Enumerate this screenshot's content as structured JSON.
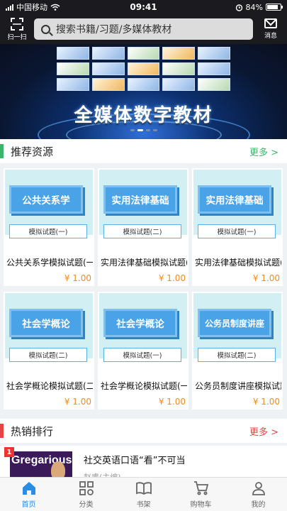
{
  "status": {
    "carrier": "中国移动",
    "time": "09:41",
    "battery": "84%"
  },
  "header": {
    "scan_label": "扫一扫",
    "search_placeholder": "搜索书籍/习题/多媒体教材",
    "message_label": "消息"
  },
  "banner": {
    "title": "全媒体数字教材",
    "dot_count": 4,
    "active_dot": 1
  },
  "recommend": {
    "title": "推荐资源",
    "more": "更多 >",
    "accent": "#3bb56b",
    "items": [
      {
        "cover_title": "公共关系学",
        "cover_sub": "模拟试题(一)",
        "name": "公共关系学模拟试题(一)",
        "price": "¥ 1.00"
      },
      {
        "cover_title": "实用法律基础",
        "cover_sub": "模拟试题(二)",
        "name": "实用法律基础模拟试题(二)",
        "price": "¥ 1.00"
      },
      {
        "cover_title": "实用法律基础",
        "cover_sub": "模拟试题(一)",
        "name": "实用法律基础模拟试题(一)",
        "price": "¥ 1.00"
      },
      {
        "cover_title": "社会学概论",
        "cover_sub": "模拟试题(二)",
        "name": "社会学概论模拟试题(二)",
        "price": "¥ 1.00"
      },
      {
        "cover_title": "社会学概论",
        "cover_sub": "模拟试题(一)",
        "name": "社会学概论模拟试题(一)",
        "price": "¥ 1.00"
      },
      {
        "cover_title": "公务员制度讲座",
        "cover_sub": "模拟试题(二)",
        "name": "公务员制度讲座模拟试题(二)",
        "price": "¥ 1.00"
      }
    ]
  },
  "hot": {
    "title": "热销排行",
    "more": "更多 >",
    "accent": "#e84343",
    "items": [
      {
        "rank": "1",
        "thumb_word": "Gregarious",
        "title": "社交英语口语“看”不可当",
        "author": "赵睿(主编)"
      }
    ]
  },
  "tabs": [
    {
      "label": "首页",
      "icon": "home-icon",
      "active": true
    },
    {
      "label": "分类",
      "icon": "category-icon",
      "active": false
    },
    {
      "label": "书架",
      "icon": "bookshelf-icon",
      "active": false
    },
    {
      "label": "购物车",
      "icon": "cart-icon",
      "active": false
    },
    {
      "label": "我的",
      "icon": "profile-icon",
      "active": false
    }
  ],
  "colors": {
    "active_tab": "#2b8be8",
    "price": "#f08c1a"
  }
}
